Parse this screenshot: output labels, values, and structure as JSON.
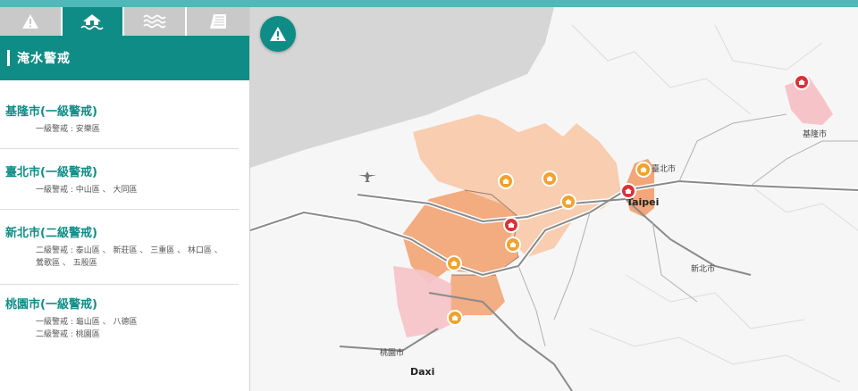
{
  "tabs": [
    {
      "icon": "warning-icon",
      "active": false
    },
    {
      "icon": "flood-house-icon",
      "active": true
    },
    {
      "icon": "waves-icon",
      "active": false
    },
    {
      "icon": "dam-icon",
      "active": false
    }
  ],
  "panel": {
    "title": "淹水警戒"
  },
  "cities": [
    {
      "name": "基隆市(一級警戒)",
      "lines": [
        "一級警戒 : 安樂區"
      ]
    },
    {
      "name": "臺北市(一級警戒)",
      "lines": [
        "一級警戒 : 中山區 、 大同區"
      ]
    },
    {
      "name": "新北市(二級警戒)",
      "lines": [
        "二級警戒 : 泰山區 、 新莊區 、 三重區 、 林口區 、",
        "鶯歌區 、 五股區"
      ]
    },
    {
      "name": "桃園市(一級警戒)",
      "lines": [
        "一級警戒 : 龜山區 、 八德區",
        "二級警戒 : 桃園區"
      ]
    }
  ],
  "map": {
    "labels": {
      "taipei": "Taipei",
      "taipei_cn": "臺北市",
      "keelung": "基隆市",
      "newtaipei": "新北市",
      "taoyuan": "桃園市",
      "daxi": "Daxi"
    },
    "colors": {
      "level1": "#f5a88a",
      "level2": "#f0b48b",
      "alert": "#f6c6c8",
      "accent": "#0f8c86"
    }
  }
}
